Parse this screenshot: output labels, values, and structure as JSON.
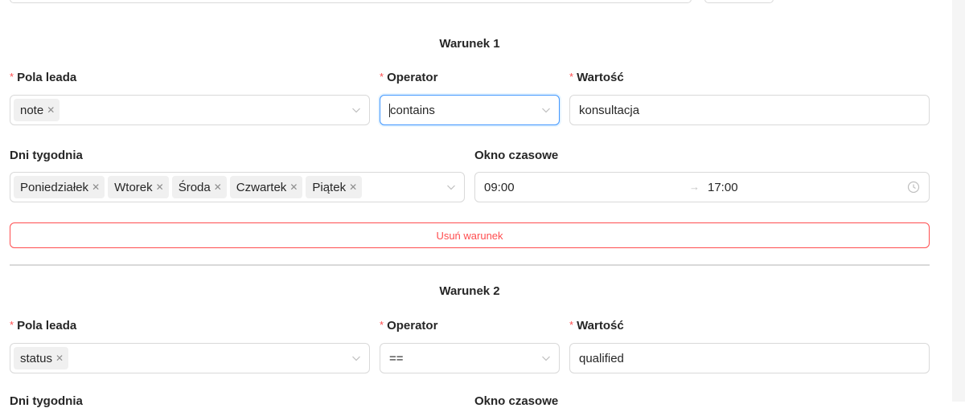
{
  "conditions": [
    {
      "title": "Warunek 1",
      "lead_field_label": "Pola leada",
      "lead_field_tags": [
        "note"
      ],
      "operator_label": "Operator",
      "operator_value": "contains",
      "value_label": "Wartość",
      "value_input": "konsultacja",
      "days_label": "Dni tygodnia",
      "days_tags": [
        "Poniedziałek",
        "Wtorek",
        "Środa",
        "Czwartek",
        "Piątek"
      ],
      "time_window_label": "Okno czasowe",
      "time_start": "09:00",
      "time_end": "17:00",
      "remove_button": "Usuń warunek"
    },
    {
      "title": "Warunek 2",
      "lead_field_label": "Pola leada",
      "lead_field_tags": [
        "status"
      ],
      "operator_label": "Operator",
      "operator_value": "==",
      "value_label": "Wartość",
      "value_input": "qualified",
      "days_label": "Dni tygodnia",
      "time_window_label": "Okno czasowe"
    }
  ],
  "icons": {
    "tag_remove": "close-icon",
    "select_arrow": "chevron-down-icon",
    "range_separator": "arrow-right-icon",
    "time_suffix": "clock-icon"
  },
  "colors": {
    "required_asterisk": "#ff4d4f",
    "danger": "#ff4d4f",
    "focus_border": "#4096ff",
    "border": "#d9d9d9",
    "tag_bg": "#f0f0f0"
  }
}
